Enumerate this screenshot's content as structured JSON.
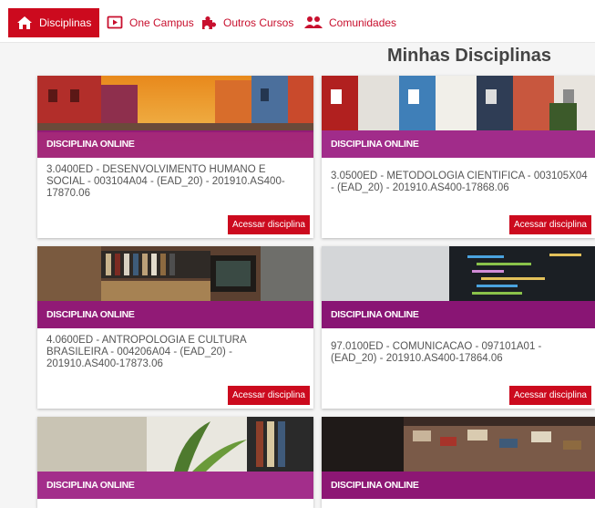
{
  "nav": {
    "items": [
      {
        "label": "Disciplinas",
        "icon": "home-icon",
        "active": true
      },
      {
        "label": "One Campus",
        "icon": "play-icon",
        "active": false
      },
      {
        "label": "Outros Cursos",
        "icon": "puzzle-icon",
        "active": false
      },
      {
        "label": "Comunidades",
        "icon": "people-icon",
        "active": false
      }
    ]
  },
  "page": {
    "title": "Minhas Disciplinas"
  },
  "courses": [
    {
      "category": "DISCIPLINA ONLINE",
      "title": "3.0400ED - DESENVOLVIMENTO HUMANO E SOCIAL - 003104A04 - (EAD_20) - 201910.AS400-17870.06",
      "button": "Acessar disciplina"
    },
    {
      "category": "DISCIPLINA ONLINE",
      "title": "3.0500ED - METODOLOGIA CIENTIFICA - 003105X04 - (EAD_20) - 201910.AS400-17868.06",
      "button": "Acessar disciplina"
    },
    {
      "category": "DISCIPLINA ONLINE",
      "title": "4.0600ED - ANTROPOLOGIA E CULTURA BRASILEIRA - 004206A04 - (EAD_20) - 201910.AS400-17873.06",
      "button": "Acessar disciplina"
    },
    {
      "category": "DISCIPLINA ONLINE",
      "title": "97.0100ED - COMUNICACAO - 097101A01 - (EAD_20) - 201910.AS400-17864.06",
      "button": "Acessar disciplina"
    },
    {
      "category": "DISCIPLINA ONLINE",
      "title": "",
      "button": ""
    },
    {
      "category": "DISCIPLINA ONLINE",
      "title": "",
      "button": ""
    }
  ],
  "colors": {
    "accent": "#cc0a1e",
    "band": "#981480"
  }
}
